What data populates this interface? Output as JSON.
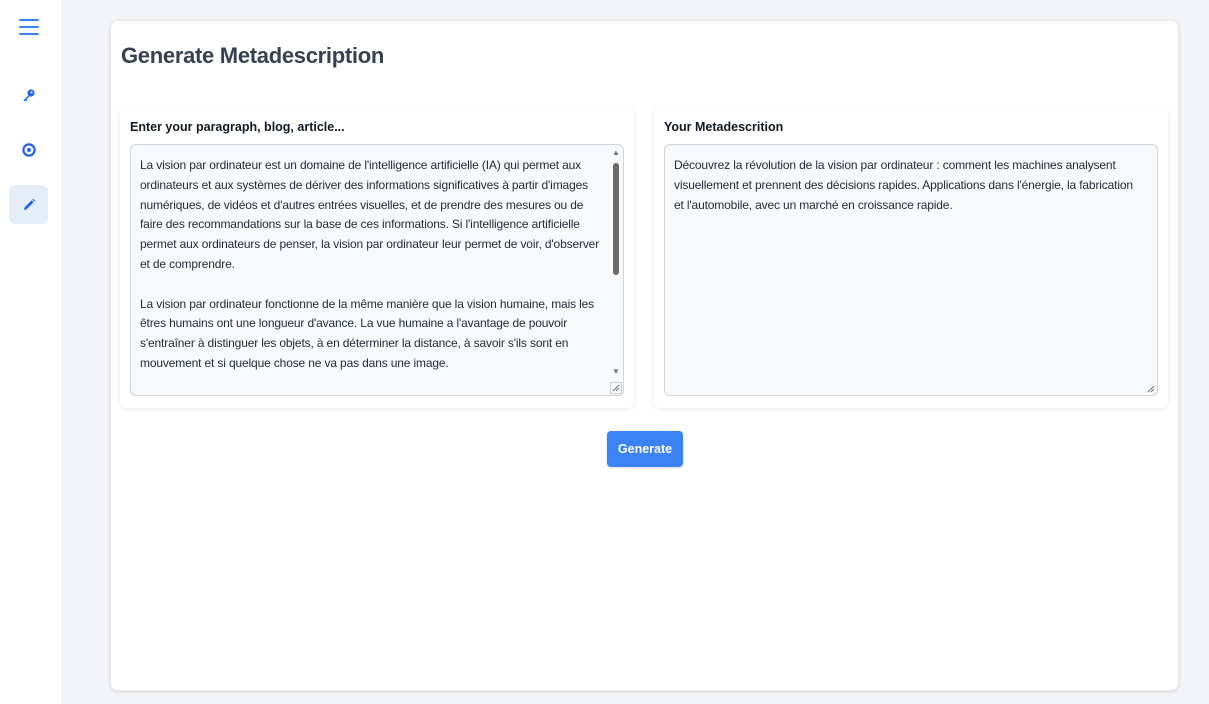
{
  "nav": {
    "items": [
      {
        "icon": "menu-icon"
      },
      {
        "icon": "key-icon"
      },
      {
        "icon": "target-icon"
      },
      {
        "icon": "pencil-icon",
        "active": true
      }
    ]
  },
  "page": {
    "title": "Generate Metadescription"
  },
  "input_panel": {
    "label": "Enter your paragraph, blog, article...",
    "value": "La vision par ordinateur est un domaine de l'intelligence artificielle (IA) qui permet aux ordinateurs et aux systèmes de dériver des informations significatives à partir d'images numériques, de vidéos et d'autres entrées visuelles, et de prendre des mesures ou de faire des recommandations sur la base de ces informations. Si l'intelligence artificielle permet aux ordinateurs de penser, la vision par ordinateur leur permet de voir, d'observer et de comprendre.\n\nLa vision par ordinateur fonctionne de la même manière que la vision humaine, mais les êtres humains ont une longueur d'avance. La vue humaine a l'avantage de pouvoir s'entraîner à distinguer les objets, à en déterminer la distance, à savoir s'ils sont en mouvement et si quelque chose ne va pas dans une image."
  },
  "output_panel": {
    "label": "Your Metadescrition",
    "value": "Découvrez la révolution de la vision par ordinateur : comment les machines analysent visuellement et prennent des décisions rapides. Applications dans l'énergie, la fabrication et l'automobile, avec un marché en croissance rapide."
  },
  "actions": {
    "generate_label": "Generate"
  },
  "colors": {
    "accent": "#3b82f6",
    "sidebar_active": "#e5edf8"
  }
}
